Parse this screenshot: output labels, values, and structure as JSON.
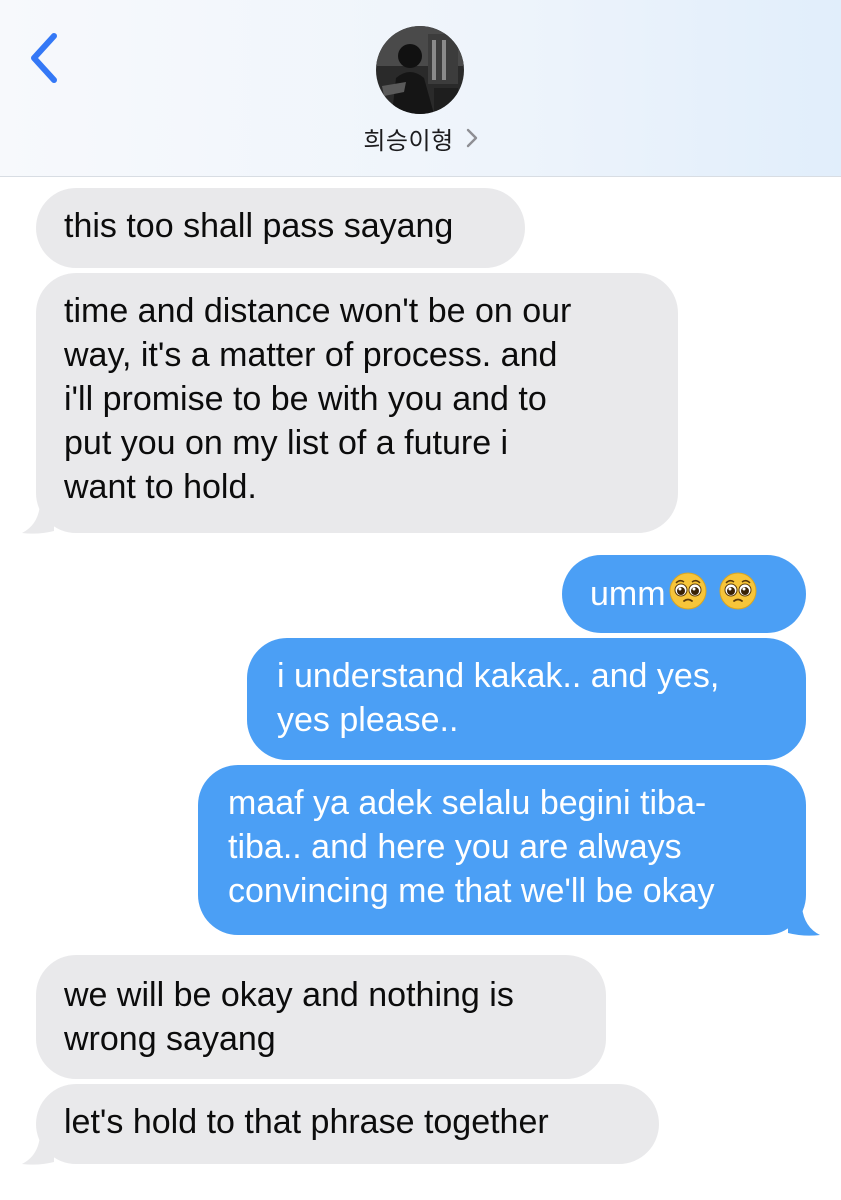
{
  "header": {
    "contact_name": "희승이형",
    "back_icon": "chevron-left-icon",
    "detail_icon": "chevron-right-icon",
    "accent_color": "#3478f6"
  },
  "messages": [
    {
      "direction": "received",
      "text": "this too shall pass sayang"
    },
    {
      "direction": "received",
      "lines": [
        "time and distance won't be on our",
        "way, it's a matter of process. and",
        "i'll promise to be with you and to",
        "put you on my list of a future i",
        "want to hold."
      ]
    },
    {
      "direction": "sent",
      "text": "umm",
      "emoji": [
        "pleading-face-emoji",
        "pleading-face-emoji"
      ]
    },
    {
      "direction": "sent",
      "lines": [
        "i understand kakak.. and yes,",
        "yes please.."
      ]
    },
    {
      "direction": "sent",
      "lines": [
        "maaf ya adek selalu begini tiba-",
        "tiba.. and here you are always",
        "convincing me that we'll be okay"
      ]
    },
    {
      "direction": "received",
      "lines": [
        "we will be okay and nothing is",
        "wrong sayang"
      ]
    },
    {
      "direction": "received",
      "text": "let's hold to that phrase together"
    }
  ],
  "colors": {
    "sent_bubble": "#4b9ff5",
    "received_bubble": "#e9e9eb"
  }
}
